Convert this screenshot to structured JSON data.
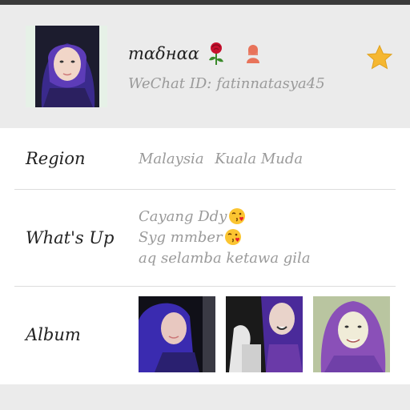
{
  "profile": {
    "nickname": "тαδнαα",
    "wechat_id_label": "WeChat ID:",
    "wechat_id": "fatinnatasya45",
    "star_icon": "star-icon",
    "rose_icon": "rose-icon",
    "gender_icon": "female-user-icon"
  },
  "details": {
    "region_label": "Region",
    "region_country": "Malaysia",
    "region_city": "Kuala Muda",
    "whatsup_label": "What's Up",
    "whatsup_lines": [
      "Cayang Ddy",
      "Syg mmber",
      "aq selamba ketawa gila"
    ],
    "album_label": "Album"
  },
  "colors": {
    "accent_star": "#f5b731",
    "gender_icon": "#e8735a",
    "label_text": "#222222",
    "value_text": "#9a9a9a"
  }
}
